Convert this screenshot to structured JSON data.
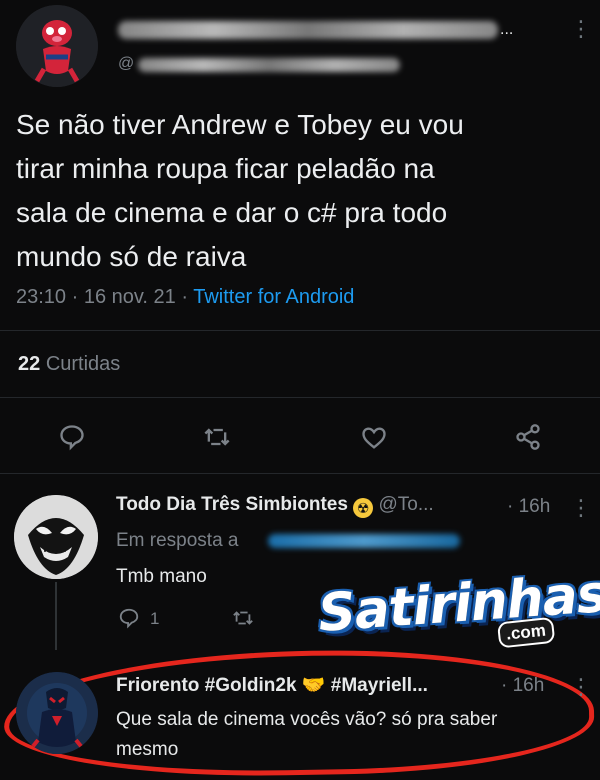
{
  "tweet": {
    "handle_prefix": "@",
    "text_lines": [
      "Se não tiver Andrew e Tobey eu vou",
      "tirar minha roupa ficar peladão na",
      "sala de cinema e dar o c# pra todo",
      "mundo só de raiva"
    ],
    "time": "23:10",
    "date": "16 nov. 21",
    "separator": "·",
    "source": "Twitter for Android",
    "likes_count": "22",
    "likes_label": "Curtidas",
    "more_menu": "⋮"
  },
  "reply1": {
    "name": "Todo Dia Três Simbiontes",
    "handle": "@To...",
    "age": "· 16h",
    "reply_to_prefix": "Em resposta a",
    "text": "Tmb mano",
    "reply_count": "1",
    "more_menu": "⋮"
  },
  "reply2": {
    "name": "Friorento #Goldin2k",
    "name_tail": "#Mayriell...",
    "age": "· 16h",
    "text_lines": [
      "Que sala de cinema vocês vão? só pra saber",
      "mesmo"
    ],
    "more_menu": "⋮"
  },
  "watermark": {
    "text": "Satirinhas",
    "suffix": ".com"
  },
  "colors": {
    "accent": "#1d9bf0",
    "highlight_circle": "#e5261d"
  },
  "icons": {
    "reply": "reply-icon",
    "retweet": "retweet-icon",
    "like": "heart-icon",
    "share": "share-icon"
  }
}
